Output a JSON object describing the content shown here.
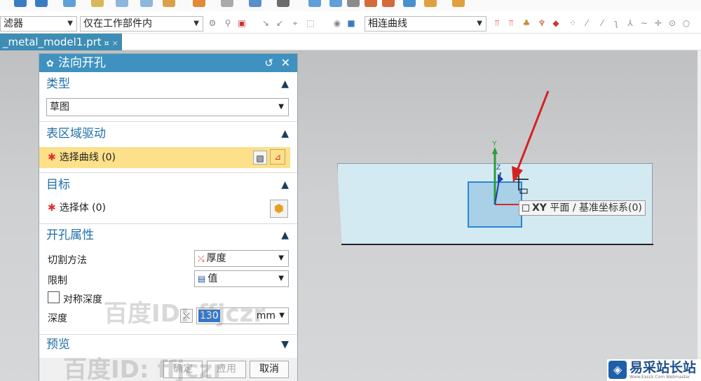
{
  "selection_bar": {
    "filter_label": "滤器",
    "scope_value": "仅在工作部件内",
    "curve_rule_value": "相连曲线"
  },
  "file_tab": {
    "name": "_metal_model1.prt",
    "pin": "¤",
    "close": "×"
  },
  "dialog": {
    "title": "法向开孔",
    "sections": {
      "type": {
        "title": "类型",
        "value": "草图"
      },
      "region": {
        "title": "表区域驱动",
        "select_label": "选择曲线 (0)"
      },
      "target": {
        "title": "目标",
        "select_label": "选择体 (0)"
      },
      "props": {
        "title": "开孔属性",
        "cut_method_label": "切割方法",
        "cut_method_value": "厚度",
        "limit_label": "限制",
        "limit_value": "值",
        "symmetric_label": "对称深度",
        "depth_label": "深度",
        "depth_value": "130",
        "depth_unit": "mm"
      },
      "preview": {
        "title": "预览"
      }
    },
    "buttons": {
      "ok": "确定",
      "apply": "应用",
      "cancel": "取消"
    }
  },
  "viewport": {
    "tooltip_bold": "XY",
    "tooltip_text": "平面 / 基准坐标系(0)",
    "axis_y": "Y",
    "axis_z": "Z"
  },
  "watermarks": {
    "mark1": "百度ID: ffjczr",
    "mark2": "百度ID: ffjczr"
  },
  "brand": {
    "name": "易采站长站",
    "sub": "Www.Easck.Com Webmaster"
  },
  "colors": {
    "title_bar": "#3f92bf",
    "file_tab": "#3d8db5",
    "section_title": "#1f6fa8",
    "active_row": "#fce08a",
    "required_star": "#e0312b"
  }
}
